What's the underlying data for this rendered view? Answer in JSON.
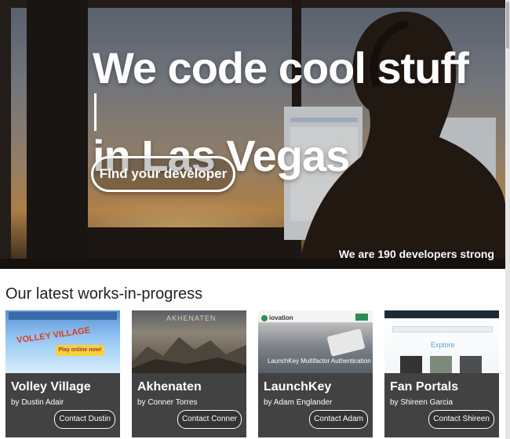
{
  "hero": {
    "headline_line1": "We code cool stuff",
    "headline_line2": "in Las Vegas",
    "cta_label": "Find your developer",
    "tagline": "We are 190 developers strong"
  },
  "works": {
    "title": "Our latest works-in-progress",
    "cards": [
      {
        "name": "Volley Village",
        "author": "by Dustin Adair",
        "contact": "Contact Dustin",
        "thumb": {
          "logo": "VOLLEY VILLAGE",
          "badge": "Play online now!"
        }
      },
      {
        "name": "Akhenaten",
        "author": "by Conner Torres",
        "contact": "Contact Conner",
        "thumb": {
          "logo": "AKHENATEN"
        }
      },
      {
        "name": "LaunchKey",
        "author": "by Adam Englander",
        "contact": "Contact Adam",
        "thumb": {
          "brand": "iovation",
          "caption": "LaunchKey Multifactor Authentication"
        }
      },
      {
        "name": "Fan Portals",
        "author": "by Shireen Garcia",
        "contact": "Contact Shireen",
        "thumb": {
          "heading": "Explore"
        }
      }
    ]
  },
  "colors": {
    "card_panel": "#343434",
    "accent_green": "#2e8b57",
    "explore_blue": "#5aa0d8"
  }
}
